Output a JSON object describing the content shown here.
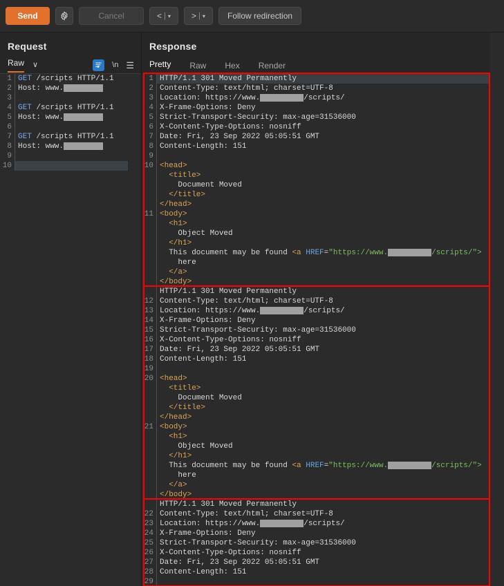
{
  "toolbar": {
    "send_label": "Send",
    "settings_icon": "gear-icon",
    "cancel_label": "Cancel",
    "back_label": "<",
    "forward_label": ">",
    "nav_separator": "|",
    "caret": "▾",
    "follow_redirection_label": "Follow redirection"
  },
  "request": {
    "title": "Request",
    "tab": "Raw",
    "chevron": "∨",
    "wrap_icon": "word-wrap-icon",
    "newline_label": "\\n",
    "menu_icon": "☰",
    "lines": [
      {
        "n": "1",
        "type": "req",
        "text": "GET /scripts HTTP/1.1"
      },
      {
        "n": "2",
        "type": "host",
        "text": "Host: www."
      },
      {
        "n": "3",
        "type": "blank",
        "text": ""
      },
      {
        "n": "4",
        "type": "req",
        "text": "GET /scripts HTTP/1.1"
      },
      {
        "n": "5",
        "type": "host",
        "text": "Host: www."
      },
      {
        "n": "6",
        "type": "blank",
        "text": ""
      },
      {
        "n": "7",
        "type": "req",
        "text": "GET /scripts HTTP/1.1"
      },
      {
        "n": "8",
        "type": "host",
        "text": "Host: www."
      },
      {
        "n": "9",
        "type": "blank",
        "text": ""
      },
      {
        "n": "10",
        "type": "blank",
        "text": "",
        "highlight": true
      }
    ]
  },
  "response": {
    "title": "Response",
    "tabs": [
      {
        "label": "Pretty",
        "active": true
      },
      {
        "label": "Raw",
        "active": false
      },
      {
        "label": "Hex",
        "active": false
      },
      {
        "label": "Render",
        "active": false
      }
    ],
    "blocks": [
      {
        "lines": [
          {
            "n": "1",
            "kind": "plain",
            "text": "HTTP/1.1 301 Moved Permanently",
            "highlight": true
          },
          {
            "n": "2",
            "kind": "plain",
            "text": "Content-Type: text/html; charset=UTF-8"
          },
          {
            "n": "3",
            "kind": "loc",
            "pre": "Location: https://www.",
            "post": "/scripts/"
          },
          {
            "n": "4",
            "kind": "plain",
            "text": "X-Frame-Options: Deny"
          },
          {
            "n": "5",
            "kind": "plain",
            "text": "Strict-Transport-Security: max-age=31536000"
          },
          {
            "n": "6",
            "kind": "plain",
            "text": "X-Content-Type-Options: nosniff"
          },
          {
            "n": "7",
            "kind": "plain",
            "text": "Date: Fri, 23 Sep 2022 05:05:51 GMT"
          },
          {
            "n": "8",
            "kind": "plain",
            "text": "Content-Length: 151"
          },
          {
            "n": "9",
            "kind": "plain",
            "text": ""
          },
          {
            "n": "10",
            "kind": "tag",
            "text": "<head>"
          },
          {
            "n": "",
            "kind": "tag",
            "text": "  <title>"
          },
          {
            "n": "",
            "kind": "plain",
            "text": "    Document Moved"
          },
          {
            "n": "",
            "kind": "tag",
            "text": "  </title>"
          },
          {
            "n": "",
            "kind": "tag",
            "text": "</head>"
          },
          {
            "n": "11",
            "kind": "tag",
            "text": "<body>"
          },
          {
            "n": "",
            "kind": "tag",
            "text": "  <h1>"
          },
          {
            "n": "",
            "kind": "plain",
            "text": "    Object Moved"
          },
          {
            "n": "",
            "kind": "tag",
            "text": "  </h1>"
          },
          {
            "n": "",
            "kind": "anchor",
            "lead": "  This document may be found ",
            "atag": "<a",
            "attr": "HREF",
            "eq": "=",
            "v1": "\"https://www.",
            "v2": "/scripts/\">"
          },
          {
            "n": "",
            "kind": "plain",
            "text": "    here"
          },
          {
            "n": "",
            "kind": "tag",
            "text": "  </a>"
          },
          {
            "n": "",
            "kind": "tag",
            "text": "</body>"
          }
        ]
      },
      {
        "lines": [
          {
            "n": "",
            "kind": "plain",
            "text": "HTTP/1.1 301 Moved Permanently"
          },
          {
            "n": "12",
            "kind": "plain",
            "text": "Content-Type: text/html; charset=UTF-8"
          },
          {
            "n": "13",
            "kind": "loc",
            "pre": "Location: https://www.",
            "post": "/scripts/"
          },
          {
            "n": "14",
            "kind": "plain",
            "text": "X-Frame-Options: Deny"
          },
          {
            "n": "15",
            "kind": "plain",
            "text": "Strict-Transport-Security: max-age=31536000"
          },
          {
            "n": "16",
            "kind": "plain",
            "text": "X-Content-Type-Options: nosniff"
          },
          {
            "n": "17",
            "kind": "plain",
            "text": "Date: Fri, 23 Sep 2022 05:05:51 GMT"
          },
          {
            "n": "18",
            "kind": "plain",
            "text": "Content-Length: 151"
          },
          {
            "n": "19",
            "kind": "plain",
            "text": ""
          },
          {
            "n": "20",
            "kind": "tag",
            "text": "<head>"
          },
          {
            "n": "",
            "kind": "tag",
            "text": "  <title>"
          },
          {
            "n": "",
            "kind": "plain",
            "text": "    Document Moved"
          },
          {
            "n": "",
            "kind": "tag",
            "text": "  </title>"
          },
          {
            "n": "",
            "kind": "tag",
            "text": "</head>"
          },
          {
            "n": "21",
            "kind": "tag",
            "text": "<body>"
          },
          {
            "n": "",
            "kind": "tag",
            "text": "  <h1>"
          },
          {
            "n": "",
            "kind": "plain",
            "text": "    Object Moved"
          },
          {
            "n": "",
            "kind": "tag",
            "text": "  </h1>"
          },
          {
            "n": "",
            "kind": "anchor",
            "lead": "  This document may be found ",
            "atag": "<a",
            "attr": "HREF",
            "eq": "=",
            "v1": "\"https://www.",
            "v2": "/scripts/\">"
          },
          {
            "n": "",
            "kind": "plain",
            "text": "    here"
          },
          {
            "n": "",
            "kind": "tag",
            "text": "  </a>"
          },
          {
            "n": "",
            "kind": "tag",
            "text": "</body>"
          }
        ]
      },
      {
        "lines": [
          {
            "n": "",
            "kind": "plain",
            "text": "HTTP/1.1 301 Moved Permanently"
          },
          {
            "n": "22",
            "kind": "plain",
            "text": "Content-Type: text/html; charset=UTF-8"
          },
          {
            "n": "23",
            "kind": "loc",
            "pre": "Location: https://www.",
            "post": "/scripts/"
          },
          {
            "n": "24",
            "kind": "plain",
            "text": "X-Frame-Options: Deny"
          },
          {
            "n": "25",
            "kind": "plain",
            "text": "Strict-Transport-Security: max-age=31536000"
          },
          {
            "n": "26",
            "kind": "plain",
            "text": "X-Content-Type-Options: nosniff"
          },
          {
            "n": "27",
            "kind": "plain",
            "text": "Date: Fri, 23 Sep 2022 05:05:51 GMT"
          },
          {
            "n": "28",
            "kind": "plain",
            "text": "Content-Length: 151"
          },
          {
            "n": "29",
            "kind": "plain",
            "text": ""
          }
        ]
      }
    ]
  },
  "colors": {
    "accent": "#e2712d",
    "annotation_box": "#ff0000",
    "editor_bg": "#2b2b2b",
    "tag": "#d8a657",
    "attr": "#6aa4e0",
    "value": "#7cbf5d",
    "method": "#7aa6e8"
  }
}
